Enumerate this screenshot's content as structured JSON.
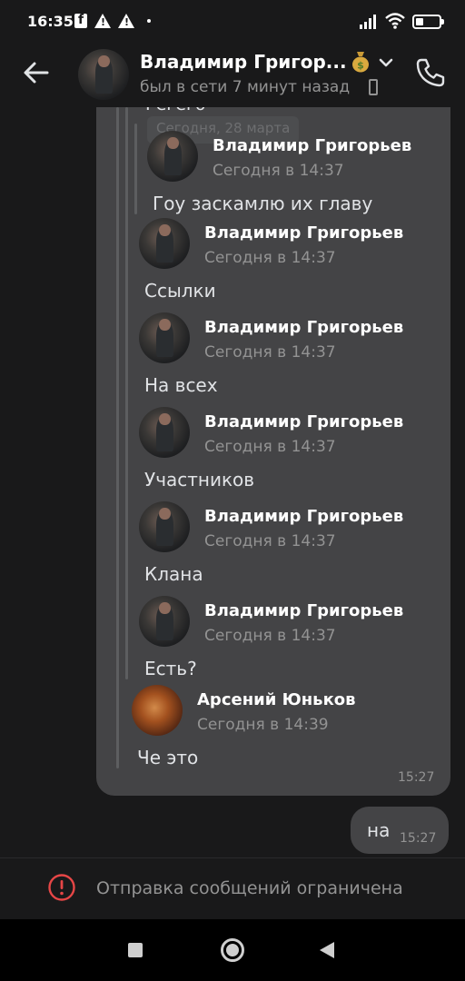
{
  "status_bar": {
    "time": "16:35"
  },
  "header": {
    "name": "Владимир Григор...",
    "status": "был в сети 7 минут назад",
    "emoji_icon": "money-bag-icon"
  },
  "conversation": {
    "cut_off_date": "Сегодня, 28 марта",
    "cut_off_text": "Гегего",
    "forwarded": [
      {
        "author": "Владимир Григорьев",
        "time": "Сегодня в 14:37",
        "text": "Гоу заскамлю их главу"
      },
      {
        "author": "Владимир Григорьев",
        "time": "Сегодня в 14:37",
        "text": "Ссылки"
      },
      {
        "author": "Владимир Григорьев",
        "time": "Сегодня в 14:37",
        "text": "На всех"
      },
      {
        "author": "Владимир Григорьев",
        "time": "Сегодня в 14:37",
        "text": "Участников"
      },
      {
        "author": "Владимир Григорьев",
        "time": "Сегодня в 14:37",
        "text": "Клана"
      },
      {
        "author": "Владимир Григорьев",
        "time": "Сегодня в 14:37",
        "text": "Есть?"
      },
      {
        "author": "Арсений Юньков",
        "time": "Сегодня в 14:39",
        "text": "Че это"
      }
    ],
    "incoming_time": "15:27",
    "outgoing": {
      "text": "на",
      "time": "15:27"
    }
  },
  "restriction": {
    "text": "Отправка сообщений ограничена"
  },
  "colors": {
    "background": "#19191a",
    "bubble": "#444446",
    "secondary_text": "#939393",
    "alert": "#e64646"
  }
}
